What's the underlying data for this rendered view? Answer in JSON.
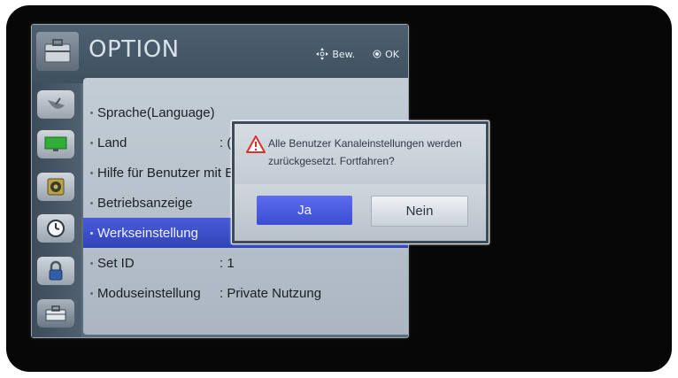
{
  "header": {
    "title": "OPTION",
    "hint_move": "Bew.",
    "hint_ok": "OK"
  },
  "sidebar": {
    "items": [
      {
        "icon": "satellite-dish-icon"
      },
      {
        "icon": "monitor-icon"
      },
      {
        "icon": "speaker-icon"
      },
      {
        "icon": "clock-icon"
      },
      {
        "icon": "lock-icon"
      },
      {
        "icon": "toolbox-icon",
        "active": true
      }
    ]
  },
  "menu": {
    "items": [
      {
        "label": "Sprache(Language)",
        "value": ""
      },
      {
        "label": "Land",
        "value": ": ("
      },
      {
        "label": "Hilfe für Benutzer mit Be",
        "value": ""
      },
      {
        "label": "Betriebsanzeige",
        "value": ""
      },
      {
        "label": "Werkseinstellung",
        "value": "",
        "selected": true
      },
      {
        "label": "Set ID",
        "value": ":  1"
      },
      {
        "label": "Moduseinstellung",
        "value": ":  Private Nutzung"
      }
    ]
  },
  "dialog": {
    "message": "Alle Benutzer Kanaleinstellungen werden zurückgesetzt. Fortfahren?",
    "confirm_label": "Ja",
    "cancel_label": "Nein"
  },
  "colors": {
    "selection": "#3a4cd0",
    "panel": "#5c6d7d",
    "warning": "#d9302a"
  }
}
